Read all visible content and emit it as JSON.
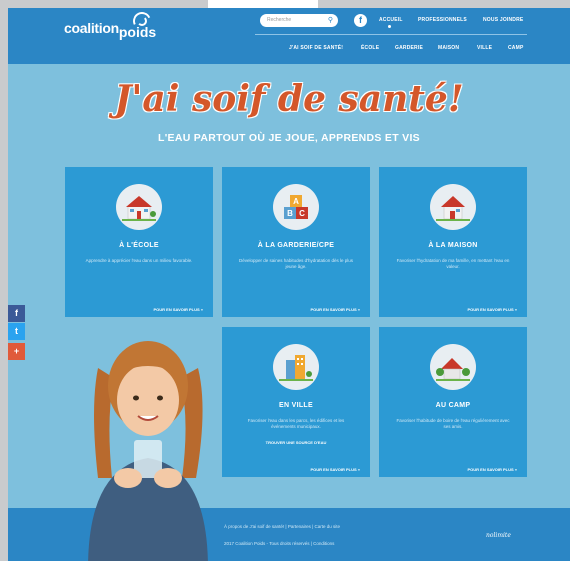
{
  "brand": {
    "logo_line1": "coalition",
    "logo_line2": "poids"
  },
  "search": {
    "placeholder": "Recherche"
  },
  "topnav": [
    "ACCUEIL",
    "PROFESSIONNELS",
    "NOUS JOINDRE"
  ],
  "subnav": [
    "J'AI SOIF DE SANTÉ!",
    "ÉCOLE",
    "GARDERIE",
    "MAISON",
    "VILLE",
    "CAMP"
  ],
  "hero": {
    "title": "J'ai soif de santé!",
    "subtitle": "L'EAU PARTOUT OÙ JE JOUE, APPRENDS ET VIS"
  },
  "cards": [
    {
      "title": "À L'ÉCOLE",
      "desc": "Apprendre à apprécier l'eau dans un milieu favorable.",
      "more": "POUR EN SAVOIR PLUS »",
      "icon": "school-icon"
    },
    {
      "title": "À LA GARDERIE/CPE",
      "desc": "Développer de saines habitudes d'hydratation dès le plus jeune âge.",
      "more": "POUR EN SAVOIR PLUS »",
      "icon": "abc-blocks-icon"
    },
    {
      "title": "À LA MAISON",
      "desc": "Favoriser l'hydratation de ma famille, en mettant l'eau en valeur.",
      "more": "POUR EN SAVOIR PLUS »",
      "icon": "house-icon"
    },
    {
      "title": "EN VILLE",
      "desc": "Favoriser l'eau dans les parcs, les édifices et les événements municipaux.",
      "find": "TROUVER UNE SOURCE D'EAU",
      "more": "POUR EN SAVOIR PLUS »",
      "icon": "city-icon"
    },
    {
      "title": "AU CAMP",
      "desc": "Favoriser l'habitude de boire de l'eau régulièrement avec ses amis.",
      "more": "POUR EN SAVOIR PLUS »",
      "icon": "camp-icon"
    }
  ],
  "social": [
    {
      "label": "f",
      "color": "#3b5a98"
    },
    {
      "label": "t",
      "color": "#2aa3ef"
    },
    {
      "label": "+",
      "color": "#e05a3a"
    }
  ],
  "footer": {
    "line1": "À propos de J'ai soif de santé!  |  Partenaires  |  Carte du site",
    "line2": "2017 Coalition Poids - Tous droits réservés  |  Conditions",
    "signature": "nolimite"
  },
  "colors": {
    "header": "#2b86c5",
    "background": "#7ec0dd",
    "card": "#2c9ad4",
    "title": "#d4572a"
  }
}
